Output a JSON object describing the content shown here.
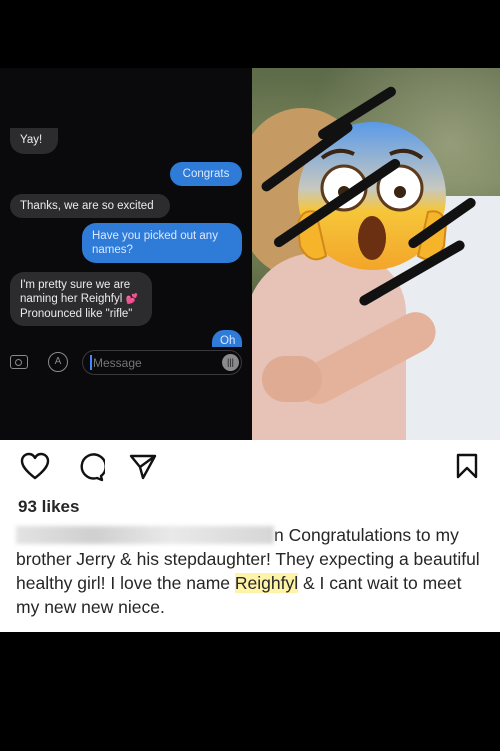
{
  "chat": {
    "messages": [
      {
        "from": "them",
        "text": "Yay!"
      },
      {
        "from": "me",
        "text": "Congrats"
      },
      {
        "from": "them",
        "text": "Thanks, we are so excited"
      },
      {
        "from": "me",
        "text": "Have you picked out any names?"
      },
      {
        "from": "them",
        "line1": "I'm pretty sure we are",
        "line2": "naming her Reighfyl",
        "line3": "Pronounced like \"rifle\""
      },
      {
        "from": "me",
        "text": "Oh"
      }
    ],
    "composer_placeholder": "Message"
  },
  "post": {
    "likes": "93 likes",
    "caption_before": "n Congratulations to my brother Jerry & his stepdaughter! They expecting a beautiful healthy girl! I love the name ",
    "caption_highlight": "Reighfyl",
    "caption_after": " & I cant wait to meet my new new niece."
  },
  "icons": [
    "camera-icon",
    "app-store-icon",
    "audio-icon",
    "heart-icon",
    "comment-icon",
    "share-icon",
    "bookmark-icon",
    "fearful-emoji"
  ]
}
